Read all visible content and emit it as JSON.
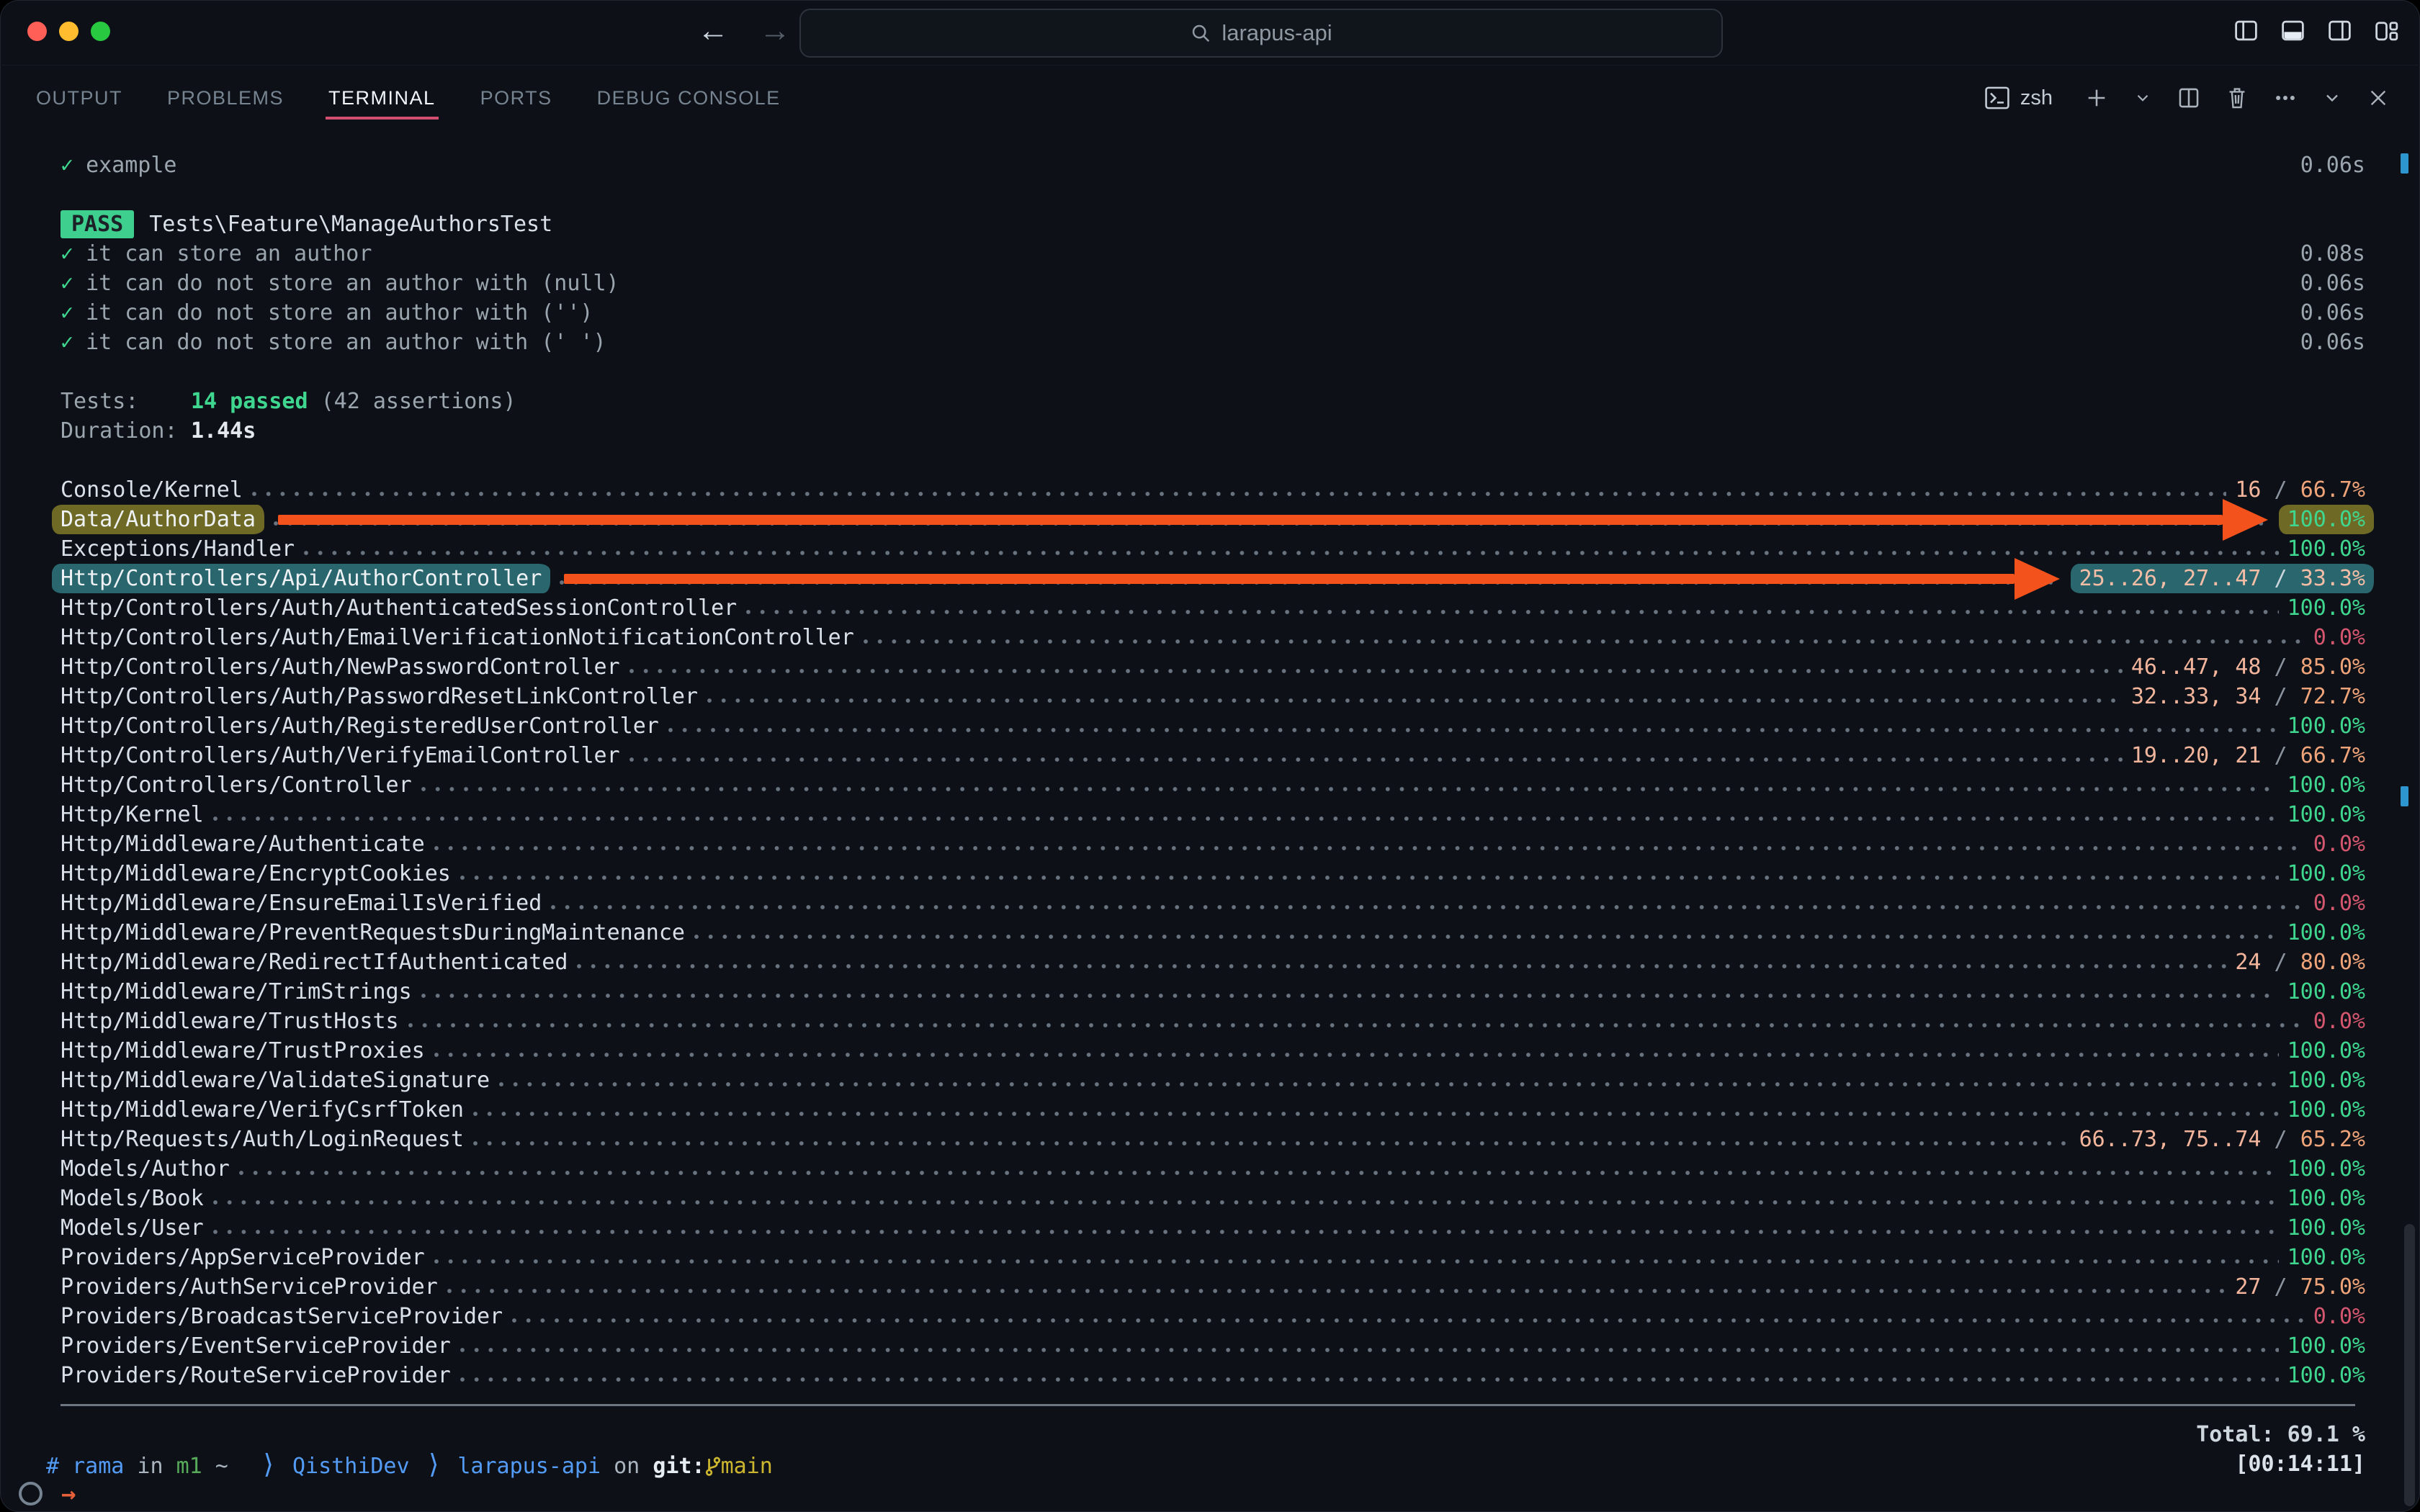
{
  "titlebar": {
    "search_text": "larapus-api",
    "traffic_lights": [
      "close",
      "minimize",
      "zoom"
    ],
    "colors": {
      "close": "#ff5f57",
      "minimize": "#febc2e",
      "zoom": "#28c840"
    }
  },
  "panel_tabs": [
    {
      "label": "OUTPUT",
      "active": false
    },
    {
      "label": "PROBLEMS",
      "active": false
    },
    {
      "label": "TERMINAL",
      "active": true
    },
    {
      "label": "PORTS",
      "active": false
    },
    {
      "label": "DEBUG CONSOLE",
      "active": false
    }
  ],
  "terminal_toolbar": {
    "shell_label": "zsh"
  },
  "test_output": {
    "example_test": {
      "name": "example",
      "time": "0.06s"
    },
    "pass_badge": "PASS",
    "suite": "Tests\\Feature\\ManageAuthorsTest",
    "cases": [
      {
        "name": "it can store an author",
        "time": "0.08s"
      },
      {
        "name": "it can do not store an author with (null)",
        "time": "0.06s"
      },
      {
        "name": "it can do not store an author with ('')",
        "time": "0.06s"
      },
      {
        "name": "it can do not store an author with (' ')",
        "time": "0.06s"
      }
    ],
    "summary": {
      "tests_label": "Tests:",
      "passed": "14 passed",
      "assertions": "(42 assertions)",
      "duration_label": "Duration:",
      "duration": "1.44s"
    }
  },
  "coverage": {
    "rows": [
      {
        "name": "Console/Kernel",
        "lines": "16",
        "pct": "66.7%",
        "status": "partial"
      },
      {
        "name": "Data/AuthorData",
        "pct": "100.0%",
        "status": "full",
        "highlight": "olive",
        "arrow": true
      },
      {
        "name": "Exceptions/Handler",
        "pct": "100.0%",
        "status": "full"
      },
      {
        "name": "Http/Controllers/Api/AuthorController",
        "lines": "25..26, 27..47",
        "pct": "33.3%",
        "status": "partial",
        "highlight": "teal",
        "arrow": true
      },
      {
        "name": "Http/Controllers/Auth/AuthenticatedSessionController",
        "pct": "100.0%",
        "status": "full"
      },
      {
        "name": "Http/Controllers/Auth/EmailVerificationNotificationController",
        "pct": "0.0%",
        "status": "zero"
      },
      {
        "name": "Http/Controllers/Auth/NewPasswordController",
        "lines": "46..47, 48",
        "pct": "85.0%",
        "status": "partial"
      },
      {
        "name": "Http/Controllers/Auth/PasswordResetLinkController",
        "lines": "32..33, 34",
        "pct": "72.7%",
        "status": "partial"
      },
      {
        "name": "Http/Controllers/Auth/RegisteredUserController",
        "pct": "100.0%",
        "status": "full"
      },
      {
        "name": "Http/Controllers/Auth/VerifyEmailController",
        "lines": "19..20, 21",
        "pct": "66.7%",
        "status": "partial"
      },
      {
        "name": "Http/Controllers/Controller",
        "pct": "100.0%",
        "status": "full"
      },
      {
        "name": "Http/Kernel",
        "pct": "100.0%",
        "status": "full"
      },
      {
        "name": "Http/Middleware/Authenticate",
        "pct": "0.0%",
        "status": "zero"
      },
      {
        "name": "Http/Middleware/EncryptCookies",
        "pct": "100.0%",
        "status": "full"
      },
      {
        "name": "Http/Middleware/EnsureEmailIsVerified",
        "pct": "0.0%",
        "status": "zero"
      },
      {
        "name": "Http/Middleware/PreventRequestsDuringMaintenance",
        "pct": "100.0%",
        "status": "full"
      },
      {
        "name": "Http/Middleware/RedirectIfAuthenticated",
        "lines": "24",
        "pct": "80.0%",
        "status": "partial"
      },
      {
        "name": "Http/Middleware/TrimStrings",
        "pct": "100.0%",
        "status": "full"
      },
      {
        "name": "Http/Middleware/TrustHosts",
        "pct": "0.0%",
        "status": "zero"
      },
      {
        "name": "Http/Middleware/TrustProxies",
        "pct": "100.0%",
        "status": "full"
      },
      {
        "name": "Http/Middleware/ValidateSignature",
        "pct": "100.0%",
        "status": "full"
      },
      {
        "name": "Http/Middleware/VerifyCsrfToken",
        "pct": "100.0%",
        "status": "full"
      },
      {
        "name": "Http/Requests/Auth/LoginRequest",
        "lines": "66..73, 75..74",
        "pct": "65.2%",
        "status": "partial"
      },
      {
        "name": "Models/Author",
        "pct": "100.0%",
        "status": "full"
      },
      {
        "name": "Models/Book",
        "pct": "100.0%",
        "status": "full"
      },
      {
        "name": "Models/User",
        "pct": "100.0%",
        "status": "full"
      },
      {
        "name": "Providers/AppServiceProvider",
        "pct": "100.0%",
        "status": "full"
      },
      {
        "name": "Providers/AuthServiceProvider",
        "lines": "27",
        "pct": "75.0%",
        "status": "partial"
      },
      {
        "name": "Providers/BroadcastServiceProvider",
        "pct": "0.0%",
        "status": "zero"
      },
      {
        "name": "Providers/EventServiceProvider",
        "pct": "100.0%",
        "status": "full"
      },
      {
        "name": "Providers/RouteServiceProvider",
        "pct": "100.0%",
        "status": "full"
      }
    ],
    "total": "Total: 69.1 %",
    "timestamp": "[00:14:11]",
    "annotation_colors": {
      "arrow": "#f4521d",
      "olive_highlight": "#6e6a26",
      "teal_highlight": "#29666e"
    },
    "status_colors": {
      "full": "#3fd68f",
      "zero": "#d5566f",
      "partial": "#efa379"
    }
  },
  "prompt": {
    "segments": [
      {
        "text": "# rama",
        "role": "blue"
      },
      {
        "text": " in ",
        "role": "fg"
      },
      {
        "text": "m1",
        "role": "green"
      },
      {
        "text": " ~",
        "role": "fg"
      },
      {
        "text": "  ⟩ ",
        "role": "bracket"
      },
      {
        "text": "QisthiDev",
        "role": "blue"
      },
      {
        "text": " ⟩ ",
        "role": "bracket"
      },
      {
        "text": "larapus-api",
        "role": "blue"
      },
      {
        "text": " on ",
        "role": "fg"
      },
      {
        "text": "git:",
        "role": "bright"
      },
      {
        "role": "branch-icon"
      },
      {
        "text": "main",
        "role": "yellow"
      }
    ],
    "continuation_arrow": "→"
  },
  "nav": {
    "back_glyph": "←",
    "forward_glyph": "→"
  }
}
